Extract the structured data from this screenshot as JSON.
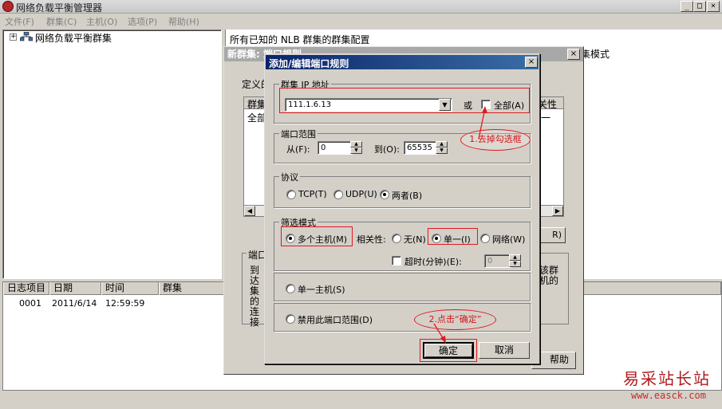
{
  "app": {
    "title": "网络负载平衡管理器",
    "minimize": "_",
    "maximize": "□",
    "close": "×"
  },
  "menu": [
    "文件(F)",
    "群集(C)",
    "主机(O)",
    "选项(P)",
    "帮助(H)"
  ],
  "tree": {
    "expander": "+",
    "root_label": "网络负载平衡群集"
  },
  "right_pane": {
    "header": "所有已知的 NLB 群集的群集配置",
    "column": "集模式"
  },
  "log": {
    "columns": [
      "日志项目",
      "日期",
      "时间",
      "群集"
    ],
    "rows": [
      {
        "id": "0001",
        "date": "2011/6/14",
        "time": "12:59:59",
        "cluster": ""
      }
    ]
  },
  "bg_dialog": {
    "title": "新群集: 端口规则",
    "define_text": "定义的",
    "list_col": "群集",
    "list_col2": "关性",
    "list_cell": "全部",
    "list_cell2": "一",
    "button_r": "R)",
    "group2_label": "端口",
    "text_left": "到达集的连接",
    "text_right": "该群机的",
    "help": "帮助"
  },
  "dialog": {
    "title": "添加/编辑端口规则",
    "close": "×",
    "cluster_ip": {
      "label": "群集 IP 地址",
      "value": "111.1.6.13",
      "or_label": "或",
      "all_label": "全部(A)",
      "all_checked": false
    },
    "port_range": {
      "label": "端口范围",
      "from_label": "从(F):",
      "from_value": "0",
      "to_label": "到(O):",
      "to_value": "65535"
    },
    "protocol": {
      "label": "协议",
      "options": [
        "TCP(T)",
        "UDP(U)",
        "两者(B)"
      ],
      "selected": "两者(B)"
    },
    "filter_mode": {
      "label": "筛选模式",
      "multi_host": "多个主机(M)",
      "affinity_label": "相关性:",
      "affinity_options": [
        "无(N)",
        "单一(I)",
        "网络(W)"
      ],
      "affinity_selected": "单一(I)",
      "timeout_label": "超时(分钟)(E):",
      "timeout_value": "0",
      "single_host": "单一主机(S)",
      "disable_range": "禁用此端口范围(D)"
    },
    "ok": "确定",
    "cancel": "取消"
  },
  "annotations": {
    "step1": "1.去掉勾选框",
    "step2": "2.点击“确定”",
    "color": "#e0191e"
  },
  "watermark": {
    "text": "易采站长站",
    "url": "www.easck.com"
  }
}
